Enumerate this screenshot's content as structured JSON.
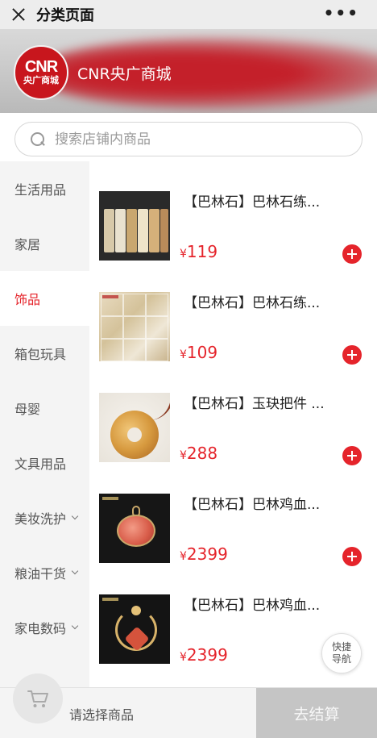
{
  "titlebar": {
    "close_icon": "close-icon",
    "title": "分类页面",
    "more_label": "•••"
  },
  "banner": {
    "logo_line1": "CNR",
    "logo_line2": "央广商城",
    "store_name": "CNR央广商城",
    "accent_color": "#c8161d"
  },
  "search": {
    "placeholder": "搜索店铺内商品",
    "value": ""
  },
  "sidebar": {
    "active_index": 2,
    "items": [
      {
        "label": "生活用品",
        "expandable": false
      },
      {
        "label": "家居",
        "expandable": false
      },
      {
        "label": "饰品",
        "expandable": false
      },
      {
        "label": "箱包玩具",
        "expandable": false
      },
      {
        "label": "母婴",
        "expandable": false
      },
      {
        "label": "文具用品",
        "expandable": false
      },
      {
        "label": "美妆洗护",
        "expandable": true
      },
      {
        "label": "粮油干货",
        "expandable": true
      },
      {
        "label": "家电数码",
        "expandable": true
      }
    ]
  },
  "products": [
    {
      "name": "【巴林石】巴林石练...",
      "currency": "¥",
      "price": "119"
    },
    {
      "name": "【巴林石】巴林石练...",
      "currency": "¥",
      "price": "109"
    },
    {
      "name": "【巴林石】玉玦把件 ...",
      "currency": "¥",
      "price": "288"
    },
    {
      "name": "【巴林石】巴林鸡血...",
      "currency": "¥",
      "price": "2399"
    },
    {
      "name": "【巴林石】巴林鸡血...",
      "currency": "¥",
      "price": "2399"
    }
  ],
  "quick_nav": {
    "line1": "快捷",
    "line2": "导航"
  },
  "bottom": {
    "cart_icon": "cart-icon",
    "hint": "请选择商品",
    "checkout_label": "去结算"
  },
  "colors": {
    "price_red": "#e5242b",
    "sidebar_bg": "#f4f4f4",
    "checkout_disabled": "#c5c5c5"
  }
}
